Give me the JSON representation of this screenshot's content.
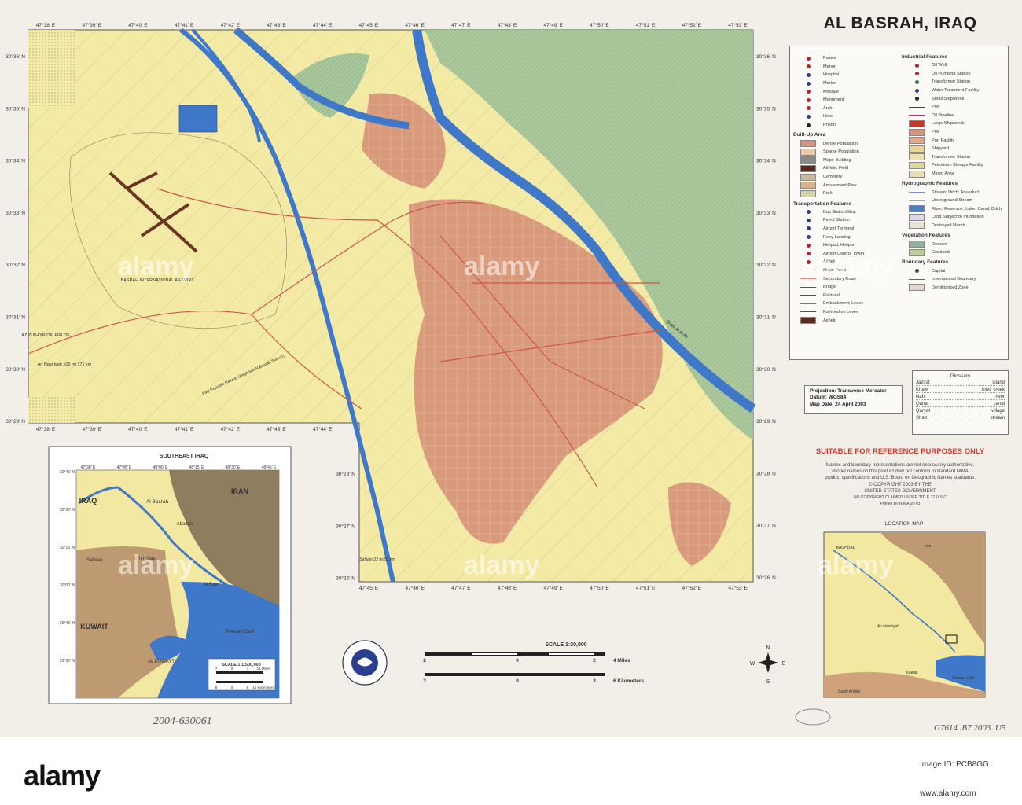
{
  "title": "AL BASRAH, IRAQ",
  "main_map": {
    "top_lon_ticks": [
      "47°38' E",
      "47°39' E",
      "47°40' E",
      "47°41' E",
      "47°42' E",
      "47°43' E",
      "47°44' E",
      "47°45' E",
      "47°46' E",
      "47°47' E",
      "47°48' E",
      "47°49' E",
      "47°50' E",
      "47°51' E",
      "47°52' E",
      "47°53' E"
    ],
    "left_lat_ticks": [
      "30°36' N",
      "30°35' N",
      "30°34' N",
      "30°33' N",
      "30°32' N",
      "30°31' N",
      "30°30' N",
      "30°29' N"
    ],
    "right_lat_ticks": [
      "30°36' N",
      "30°35' N",
      "30°34' N",
      "30°33' N",
      "30°32' N",
      "30°31' N",
      "30°30' N",
      "30°29' N",
      "30°28' N",
      "30°27' N",
      "30°26' N"
    ],
    "bottom_left_lon_ticks": [
      "47°38' E",
      "47°39' E",
      "47°40' E",
      "47°41' E",
      "47°42' E",
      "47°43' E",
      "47°44' E"
    ],
    "bottom_right_lon_ticks": [
      "47°45' E",
      "47°46' E",
      "47°47' E",
      "47°48' E",
      "47°49' E",
      "47°50' E",
      "47°51' E",
      "47°52' E",
      "47°53' E"
    ],
    "lower_lat_ticks": [
      "30°28' N",
      "30°27' N",
      "30°26' N"
    ],
    "labels": {
      "airport": "BASRAH INTERNATIONAL AIRPORT",
      "oilfield": "AZ ZUBAYR OIL FIELDS",
      "nasiriyah": "An Nasiriyah 106 mi 171 km",
      "railway": "Iraqi Republic Railway (Baghdad-Al Basrah Branch)",
      "safwan": "Safwan 32 mi 52 km",
      "shatt": "Shatt al Arab"
    }
  },
  "inset": {
    "title": "SOUTHEAST IRAQ",
    "labels": [
      "IRAQ",
      "IRAN",
      "Al Basrah",
      "Abadan",
      "Safwan",
      "Umm Qasr",
      "Al Faw",
      "KUWAIT",
      "Persian Gulf",
      "AL KUWAYT"
    ],
    "scale_title": "SCALE 1:1,500,000",
    "miles_ticks": [
      "7",
      "0",
      "7",
      "14 Miles"
    ],
    "km_ticks": [
      "8",
      "0",
      "8",
      "16 Kilometers"
    ],
    "top_ticks": [
      "47°30' E",
      "47°45' E",
      "48°00' E",
      "48°15' E",
      "48°30' E",
      "48°45' E"
    ],
    "left_ticks": [
      "30°45' N",
      "30°30' N",
      "30°15' N",
      "30°00' N",
      "29°45' N",
      "29°30' N"
    ]
  },
  "scale": {
    "title": "SCALE 1:30,000",
    "miles_ticks": [
      "2",
      "0",
      "2",
      "4 Miles"
    ],
    "km_ticks": [
      "3",
      "0",
      "3",
      "6 Kilometers"
    ]
  },
  "compass": {
    "n": "N",
    "s": "S",
    "e": "E",
    "w": "W"
  },
  "legend": {
    "left": [
      {
        "kind": "head",
        "label": ""
      },
      {
        "kind": "pt",
        "label": "Palace",
        "color": "#b0282c"
      },
      {
        "kind": "pt",
        "label": "Manor",
        "color": "#b0282c"
      },
      {
        "kind": "pt",
        "label": "Hospital",
        "color": "#2b3f8e"
      },
      {
        "kind": "pt",
        "label": "Market",
        "color": "#2b3f8e"
      },
      {
        "kind": "pt",
        "label": "Mosque",
        "color": "#b0282c"
      },
      {
        "kind": "pt",
        "label": "Monument",
        "color": "#b0282c"
      },
      {
        "kind": "pt",
        "label": "Arch",
        "color": "#b0282c"
      },
      {
        "kind": "pt",
        "label": "Hotel",
        "color": "#2b3f8e"
      },
      {
        "kind": "pt",
        "label": "Prison",
        "color": "#222"
      },
      {
        "kind": "head",
        "label": "Built-Up Area"
      },
      {
        "kind": "sw",
        "label": "Dense Population",
        "color": "#d9937a"
      },
      {
        "kind": "sw",
        "label": "Sparse Population",
        "color": "#ecc7a9"
      },
      {
        "kind": "sw",
        "label": "Major Building",
        "color": "#8a8a8a"
      },
      {
        "kind": "sw",
        "label": "Athletic Field",
        "color": "#5a2a1e"
      },
      {
        "kind": "sw",
        "label": "Cemetery",
        "color": "#c9b9a0"
      },
      {
        "kind": "sw",
        "label": "Amusement Park",
        "color": "#d9b28c"
      },
      {
        "kind": "sw",
        "label": "Park",
        "color": "#cfd8a3"
      },
      {
        "kind": "head",
        "label": "Transportation Features"
      },
      {
        "kind": "pt",
        "label": "Bus Station/Stop",
        "color": "#2b3f8e"
      },
      {
        "kind": "pt",
        "label": "Petrol Station",
        "color": "#2b3f8e"
      },
      {
        "kind": "pt",
        "label": "Airport Terminal",
        "color": "#2b3f8e"
      },
      {
        "kind": "pt",
        "label": "Ferry Landing",
        "color": "#2b3f8e"
      },
      {
        "kind": "pt",
        "label": "Helipad; Heliport",
        "color": "#b0282c"
      },
      {
        "kind": "pt",
        "label": "Airport Control Tower",
        "color": "#b0282c"
      },
      {
        "kind": "pt",
        "label": "Airfield",
        "color": "#b0282c"
      },
      {
        "kind": "ln",
        "label": "Major Road",
        "color": "#d0554a"
      },
      {
        "kind": "ln",
        "label": "Secondary Road",
        "color": "#e08a7a"
      },
      {
        "kind": "ln",
        "label": "Bridge",
        "color": "#555"
      },
      {
        "kind": "ln",
        "label": "Railroad",
        "color": "#555"
      },
      {
        "kind": "ln",
        "label": "Embankment; Levee",
        "color": "#777"
      },
      {
        "kind": "ln",
        "label": "Railroad on Levee",
        "color": "#555"
      },
      {
        "kind": "sw",
        "label": "Airfield",
        "color": "#5a2a1e"
      }
    ],
    "right": [
      {
        "kind": "head",
        "label": "Industrial Features"
      },
      {
        "kind": "pt",
        "label": "Oil Well",
        "color": "#b0282c"
      },
      {
        "kind": "pt",
        "label": "Oil Pumping Station",
        "color": "#b0282c"
      },
      {
        "kind": "pt",
        "label": "Transformer Station",
        "color": "#3a7a3a"
      },
      {
        "kind": "pt",
        "label": "Water Treatment Facility",
        "color": "#2b3f8e"
      },
      {
        "kind": "pt",
        "label": "Small Shipwreck",
        "color": "#222"
      },
      {
        "kind": "ln",
        "label": "Pier",
        "color": "#444"
      },
      {
        "kind": "ln",
        "label": "Oil Pipeline",
        "color": "#c03060"
      },
      {
        "kind": "sw",
        "label": "Large Shipwreck",
        "color": "#c0392b"
      },
      {
        "kind": "sw",
        "label": "Pier",
        "color": "#d9937a"
      },
      {
        "kind": "sw",
        "label": "Port Facility",
        "color": "#e4a78a"
      },
      {
        "kind": "sw",
        "label": "Shipyard",
        "color": "#e8d49a"
      },
      {
        "kind": "sw",
        "label": "Transformer Station",
        "color": "#ece3b4"
      },
      {
        "kind": "sw",
        "label": "Petroleum Storage Facility",
        "color": "#e0d6a0"
      },
      {
        "kind": "sw",
        "label": "Mined Area",
        "color": "#e6dcb8"
      },
      {
        "kind": "head",
        "label": "Hydrographic Features"
      },
      {
        "kind": "ln",
        "label": "Stream; Ditch; Aqueduct",
        "color": "#7a8fd0"
      },
      {
        "kind": "ln",
        "label": "Underground Stream",
        "color": "#9aa8d8"
      },
      {
        "kind": "sw",
        "label": "River; Reservoir; Lake; Canal; Ditch",
        "color": "#4d7fc4"
      },
      {
        "kind": "sw",
        "label": "Land Subject to Inundation",
        "color": "#dcd6e8"
      },
      {
        "kind": "sw",
        "label": "Destroyed Marsh",
        "color": "#e9e3d2"
      },
      {
        "kind": "head",
        "label": "Vegetation Features"
      },
      {
        "kind": "sw",
        "label": "Orchard",
        "color": "#8fb39a"
      },
      {
        "kind": "sw",
        "label": "Cropland",
        "color": "#b9cf9a"
      },
      {
        "kind": "head",
        "label": "Boundary Features"
      },
      {
        "kind": "pt",
        "label": "Capital",
        "color": "#444"
      },
      {
        "kind": "ln",
        "label": "International Boundary",
        "color": "#c0392b"
      },
      {
        "kind": "sw",
        "label": "Demilitarized Zone",
        "color": "#e6d6cc"
      }
    ]
  },
  "projection": {
    "line1": "Projection: Transverse Mercator",
    "line2": "Datum: WGS84",
    "line3": "Map Date: 24 April 2003"
  },
  "glossary": {
    "title": "Glossary",
    "rows": [
      {
        "term": "Jazirat",
        "meaning": "island"
      },
      {
        "term": "Khawr",
        "meaning": "inlet, creek"
      },
      {
        "term": "Nahr",
        "meaning": "river"
      },
      {
        "term": "Qanat",
        "meaning": "canal"
      },
      {
        "term": "Qaryat",
        "meaning": "village"
      },
      {
        "term": "Shatt",
        "meaning": "stream"
      }
    ]
  },
  "notice": "SUITABLE FOR REFERENCE PURPOSES ONLY",
  "disclaimer": {
    "l1": "Names and boundary representations are not necessarily authoritative.",
    "l2": "Proper names on this product may not conform to standard NIMA",
    "l3": "product specifications and U.S. Board on Geographic Names standards.",
    "l4": "© COPYRIGHT 2003 BY THE",
    "l5": "UNITED STATES GOVERNMENT",
    "l6": "NO COPYRIGHT CLAIMED UNDER TITLE 17 U.S.C",
    "l7": "Printed By NIMA   05-03"
  },
  "location_map": {
    "title": "LOCATION MAP",
    "labels": [
      "Iran",
      "BAGHDAD",
      "An Nasiriyah",
      "Kuwait",
      "Saudi Arabia",
      "Persian Gulf"
    ]
  },
  "handwriting": {
    "left": "2004-630061",
    "right": "G7614 .B7 2003 .U5"
  },
  "stock": {
    "logo": "alamy",
    "image_id_label": "Image ID: PCB8GG",
    "url": "www.alamy.com",
    "watermark": "alamy"
  },
  "colors": {
    "land": "#f3eaa6",
    "urban": "#d99a7c",
    "crop": "#a9c79a",
    "water": "#3f78c8",
    "road": "#d0554a"
  }
}
